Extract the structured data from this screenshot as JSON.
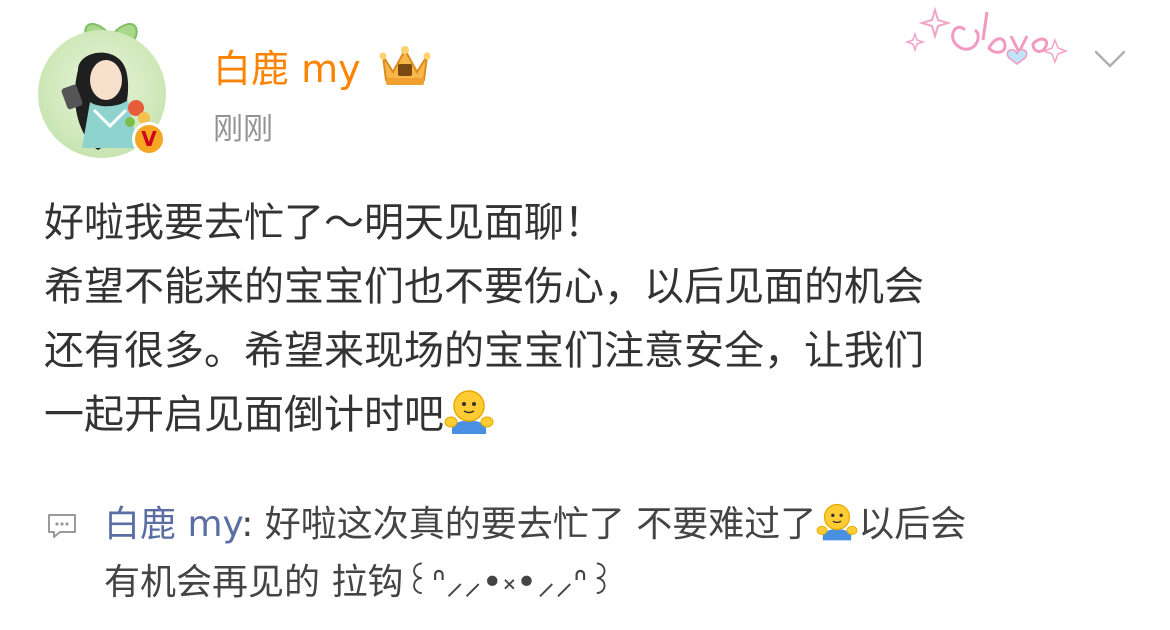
{
  "post": {
    "author": "白鹿 my",
    "timestamp": "刚刚",
    "lines": [
      "好啦我要去忙了～明天见面聊！",
      "希望不能来的宝宝们也不要伤心，以后见面的机会",
      "还有很多。希望来现场的宝宝们注意安全，让我们",
      "一起开启见面倒计时吧"
    ],
    "line_end_emoji": "hug-emoji"
  },
  "comment": {
    "author": "白鹿 my",
    "separator": ": ",
    "text_part1": "好啦这次真的要去忙了 不要难过了",
    "text_part2": "以后会",
    "text_line2": "有机会再见的 拉钩꒰ᐢ⸝⸝•༝•⸝⸝ᐢ꒱"
  },
  "icons": {
    "vip_badge": "crown-icon",
    "verified_badge": "verified-v-icon",
    "decoration": "love-sparkle-decoration",
    "menu": "chevron-down-icon",
    "comment": "comment-icon",
    "verified_letter": "V"
  },
  "colors": {
    "username": "#ff8200",
    "timestamp": "#939393",
    "body_text": "#333333",
    "comment_author": "#5b6ea3",
    "verified_bg": "#f5a623"
  }
}
